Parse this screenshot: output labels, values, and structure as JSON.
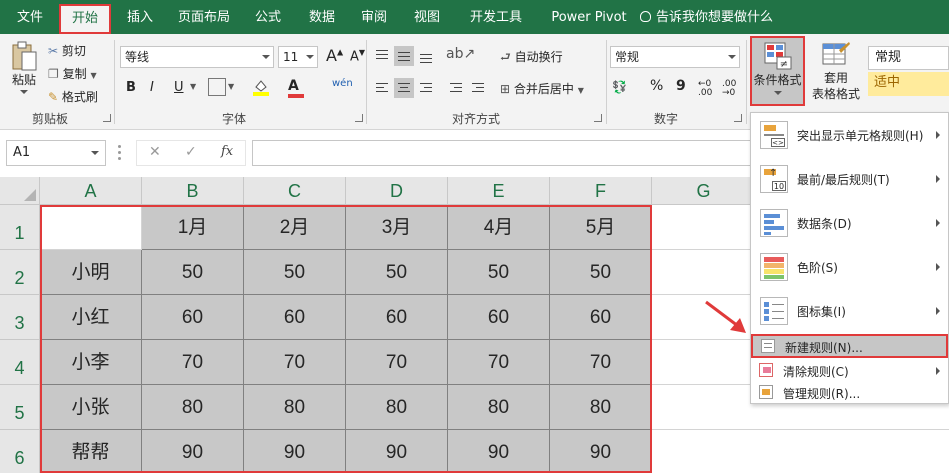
{
  "tabs": {
    "file": "文件",
    "home": "开始",
    "insert": "插入",
    "layout": "页面布局",
    "formulas": "公式",
    "data": "数据",
    "review": "审阅",
    "view": "视图",
    "developer": "开发工具",
    "powerpivot": "Power Pivot",
    "tellme": "告诉我你想要做什么"
  },
  "clipboard": {
    "paste": "粘贴",
    "cut": "剪切",
    "copy": "复制",
    "format_painter": "格式刷",
    "group": "剪贴板"
  },
  "font": {
    "name": "等线",
    "size": "11",
    "bold": "B",
    "italic": "I",
    "underline": "U",
    "font_color_glyph": "A",
    "phonetic": "wén",
    "group": "字体"
  },
  "alignment": {
    "wrap": "自动换行",
    "merge": "合并后居中",
    "group": "对齐方式"
  },
  "number": {
    "format": "常规",
    "percent": "%",
    "comma": "9",
    "group": "数字"
  },
  "styles": {
    "conditional": "条件格式",
    "table_format_1": "套用",
    "table_format_2": "表格格式",
    "normal": "常规",
    "neutral": "适中"
  },
  "namebox": {
    "value": "A1"
  },
  "formula": {
    "cancel": "✕",
    "enter": "✓",
    "fx": "fx"
  },
  "grid": {
    "columns": [
      "A",
      "B",
      "C",
      "D",
      "E",
      "F",
      "G"
    ],
    "rows": [
      "1",
      "2",
      "3",
      "4",
      "5",
      "6"
    ],
    "header": [
      "",
      "1月",
      "2月",
      "3月",
      "4月",
      "5月"
    ],
    "data": [
      [
        "小明",
        "50",
        "50",
        "50",
        "50",
        "50"
      ],
      [
        "小红",
        "60",
        "60",
        "60",
        "60",
        "60"
      ],
      [
        "小李",
        "70",
        "70",
        "70",
        "70",
        "70"
      ],
      [
        "小张",
        "80",
        "80",
        "80",
        "80",
        "80"
      ],
      [
        "帮帮",
        "90",
        "90",
        "90",
        "90",
        "90"
      ]
    ]
  },
  "menu": {
    "highlight_rules": "突出显示单元格规则(H)",
    "top_bottom": "最前/最后规则(T)",
    "data_bars": "数据条(D)",
    "color_scales": "色阶(S)",
    "icon_sets": "图标集(I)",
    "new_rule": "新建规则(N)...",
    "clear_rules": "清除规则(C)",
    "manage_rules": "管理规则(R)...",
    "top_bottom_icon_num": "10"
  },
  "colors": {
    "excel_green": "#217346",
    "highlight_red": "#e03a3a",
    "fill_gray": "#c8c8c8",
    "neutral_yellow": "#ffeb9c"
  }
}
